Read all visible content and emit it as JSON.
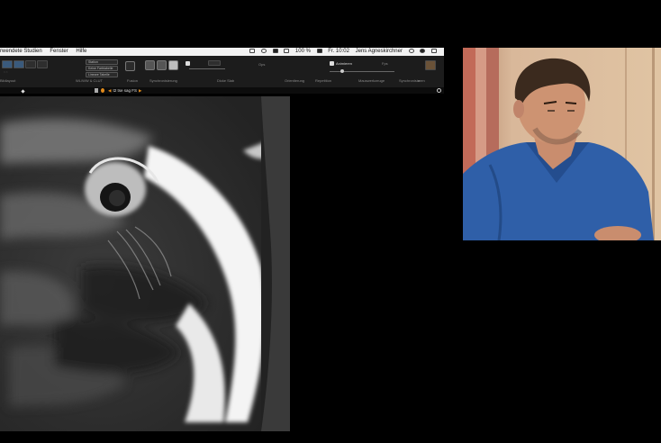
{
  "menubar": {
    "items": [
      "rwendete Studien",
      "Fenster",
      "Hilfe"
    ],
    "battery": "100 %",
    "clock": "Fr. 10:02",
    "user": "Jens Agneskirchner",
    "icons": [
      "bluetooth-icon",
      "timemachine-icon",
      "display-icon",
      "volume-icon",
      "battery-icon",
      "search-icon",
      "siri-icon",
      "notifications-icon"
    ]
  },
  "toolbar": {
    "dropdowns": [
      "Station",
      "Keine Farbtabelle",
      "Lineare Tabelle"
    ],
    "labels": {
      "layout": "Bildlayout",
      "wl": "WL/WW & CLUT",
      "fusion": "Fusion",
      "sync": "Synchronisierung",
      "thick": "Dicke Slab",
      "ops": "Ops",
      "orient": "Orientierung",
      "repetition": "Repetition",
      "mouse": "Mauswerkzeuge",
      "anim": "Animieren",
      "speed": "Fps",
      "sync_scroll": "Synchronisieren"
    }
  },
  "series": {
    "prefix": "◀",
    "title": "t2 tse sag FS",
    "suffix": "▶"
  },
  "colors": {
    "menubar_bg": "#f2f2f2",
    "toolbar_bg": "#1c1c1c",
    "accent_orange": "#e08a1c",
    "scrub_blue": "#3a5a7c",
    "scrubs": "#2f5fa8"
  }
}
